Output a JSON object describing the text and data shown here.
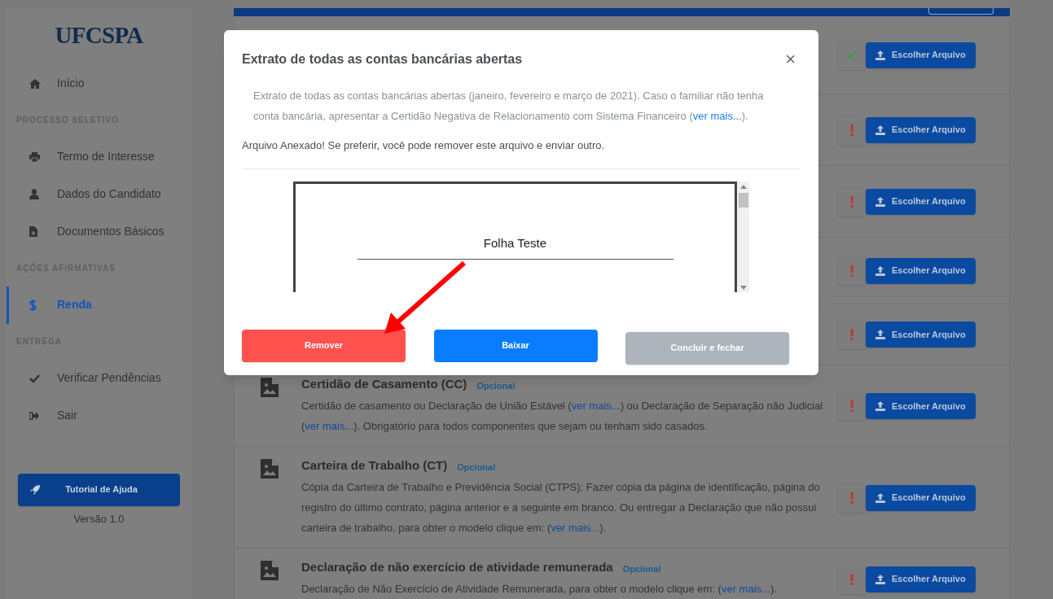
{
  "sidebar": {
    "logo": "UFCSPA",
    "items": [
      {
        "kind": "link",
        "label": "Início",
        "selected": false
      },
      {
        "kind": "heading",
        "label": "PROCESSO SELETIVO"
      },
      {
        "kind": "link",
        "label": "Termo de Interesse",
        "selected": false
      },
      {
        "kind": "link",
        "label": "Dados do Candidato",
        "selected": false
      },
      {
        "kind": "link",
        "label": "Documentos Básicos",
        "selected": false
      },
      {
        "kind": "heading",
        "label": "AÇÕES AFIRMATIVAS"
      },
      {
        "kind": "link",
        "label": "Renda",
        "selected": true
      },
      {
        "kind": "heading",
        "label": "ENTREGA"
      },
      {
        "kind": "link",
        "label": "Verificar Pendências",
        "selected": false
      },
      {
        "kind": "link",
        "label": "Sair",
        "selected": false
      }
    ],
    "help_button": "Tutorial de Ajuda",
    "version": "Versão 1.0"
  },
  "documents": [
    {
      "attached": true,
      "button": "Escolher Arquivo"
    },
    {
      "attached": false,
      "button": "Escolher Arquivo"
    },
    {
      "attached": false,
      "button": "Escolher Arquivo"
    },
    {
      "attached": false,
      "button": "Escolher Arquivo"
    },
    {
      "attached": false,
      "button": "Escolher Arquivo"
    },
    {
      "title": "Certidão de Casamento (CC)",
      "badge": "Opcional",
      "description": [
        {
          "text": "Certidão de casamento ou Declaração de União Estável ("
        },
        {
          "link": "ver mais..."
        },
        {
          "text": ") ou Declaração de Separação não Judicial ("
        },
        {
          "link": "ver mais..."
        },
        {
          "text": "). Obrigatório para todos componentes que sejam ou tenham sido casados."
        }
      ],
      "attached": false,
      "button": "Escolher Arquivo"
    },
    {
      "title": "Carteira de Trabalho (CT)",
      "badge": "Opcional",
      "description": [
        {
          "text": "Cópia da Carteira de Trabalho e Previdência Social (CTPS): Fazer cópia da página de identificação, página do registro do último contrato, página anterior e a seguinte em branco. Ou entregar a Declaração que não possui carteira de trabalho, para obter o modelo clique em: ("
        },
        {
          "link": "ver mais..."
        },
        {
          "text": ")."
        }
      ],
      "attached": false,
      "button": "Escolher Arquivo"
    },
    {
      "title": "Declaração de não exercício de atividade remunerada",
      "badge": "Opcional",
      "description": [
        {
          "text": "Declaração de Não Exercício de Atividade Remunerada, para obter o modelo clique em: ("
        },
        {
          "link": "ver mais..."
        },
        {
          "text": ")."
        }
      ],
      "attached": false,
      "button": "Escolher Arquivo"
    }
  ],
  "modal": {
    "title": "Extrato de todas as contas bancárias abertas",
    "close": "×",
    "description": [
      {
        "text": "Extrato de todas as contas bancárias abertas (janeiro, fevereiro e março de 2021). Caso o familiar não tenha conta bancária, apresentar a Certidão Negativa de Relacionamento com Sistema Financeiro ("
      },
      {
        "link": "ver mais..."
      },
      {
        "text": ")."
      }
    ],
    "note": "Arquivo Anexado! Se preferir, você pode remover este arquivo e enviar outro.",
    "preview": {
      "heading": "Folha Teste"
    },
    "buttons": [
      {
        "label": "Remover",
        "kind": "danger"
      },
      {
        "label": "Baixar",
        "kind": "primary"
      },
      {
        "label": "Concluir e fechar",
        "kind": "disabled"
      }
    ]
  }
}
